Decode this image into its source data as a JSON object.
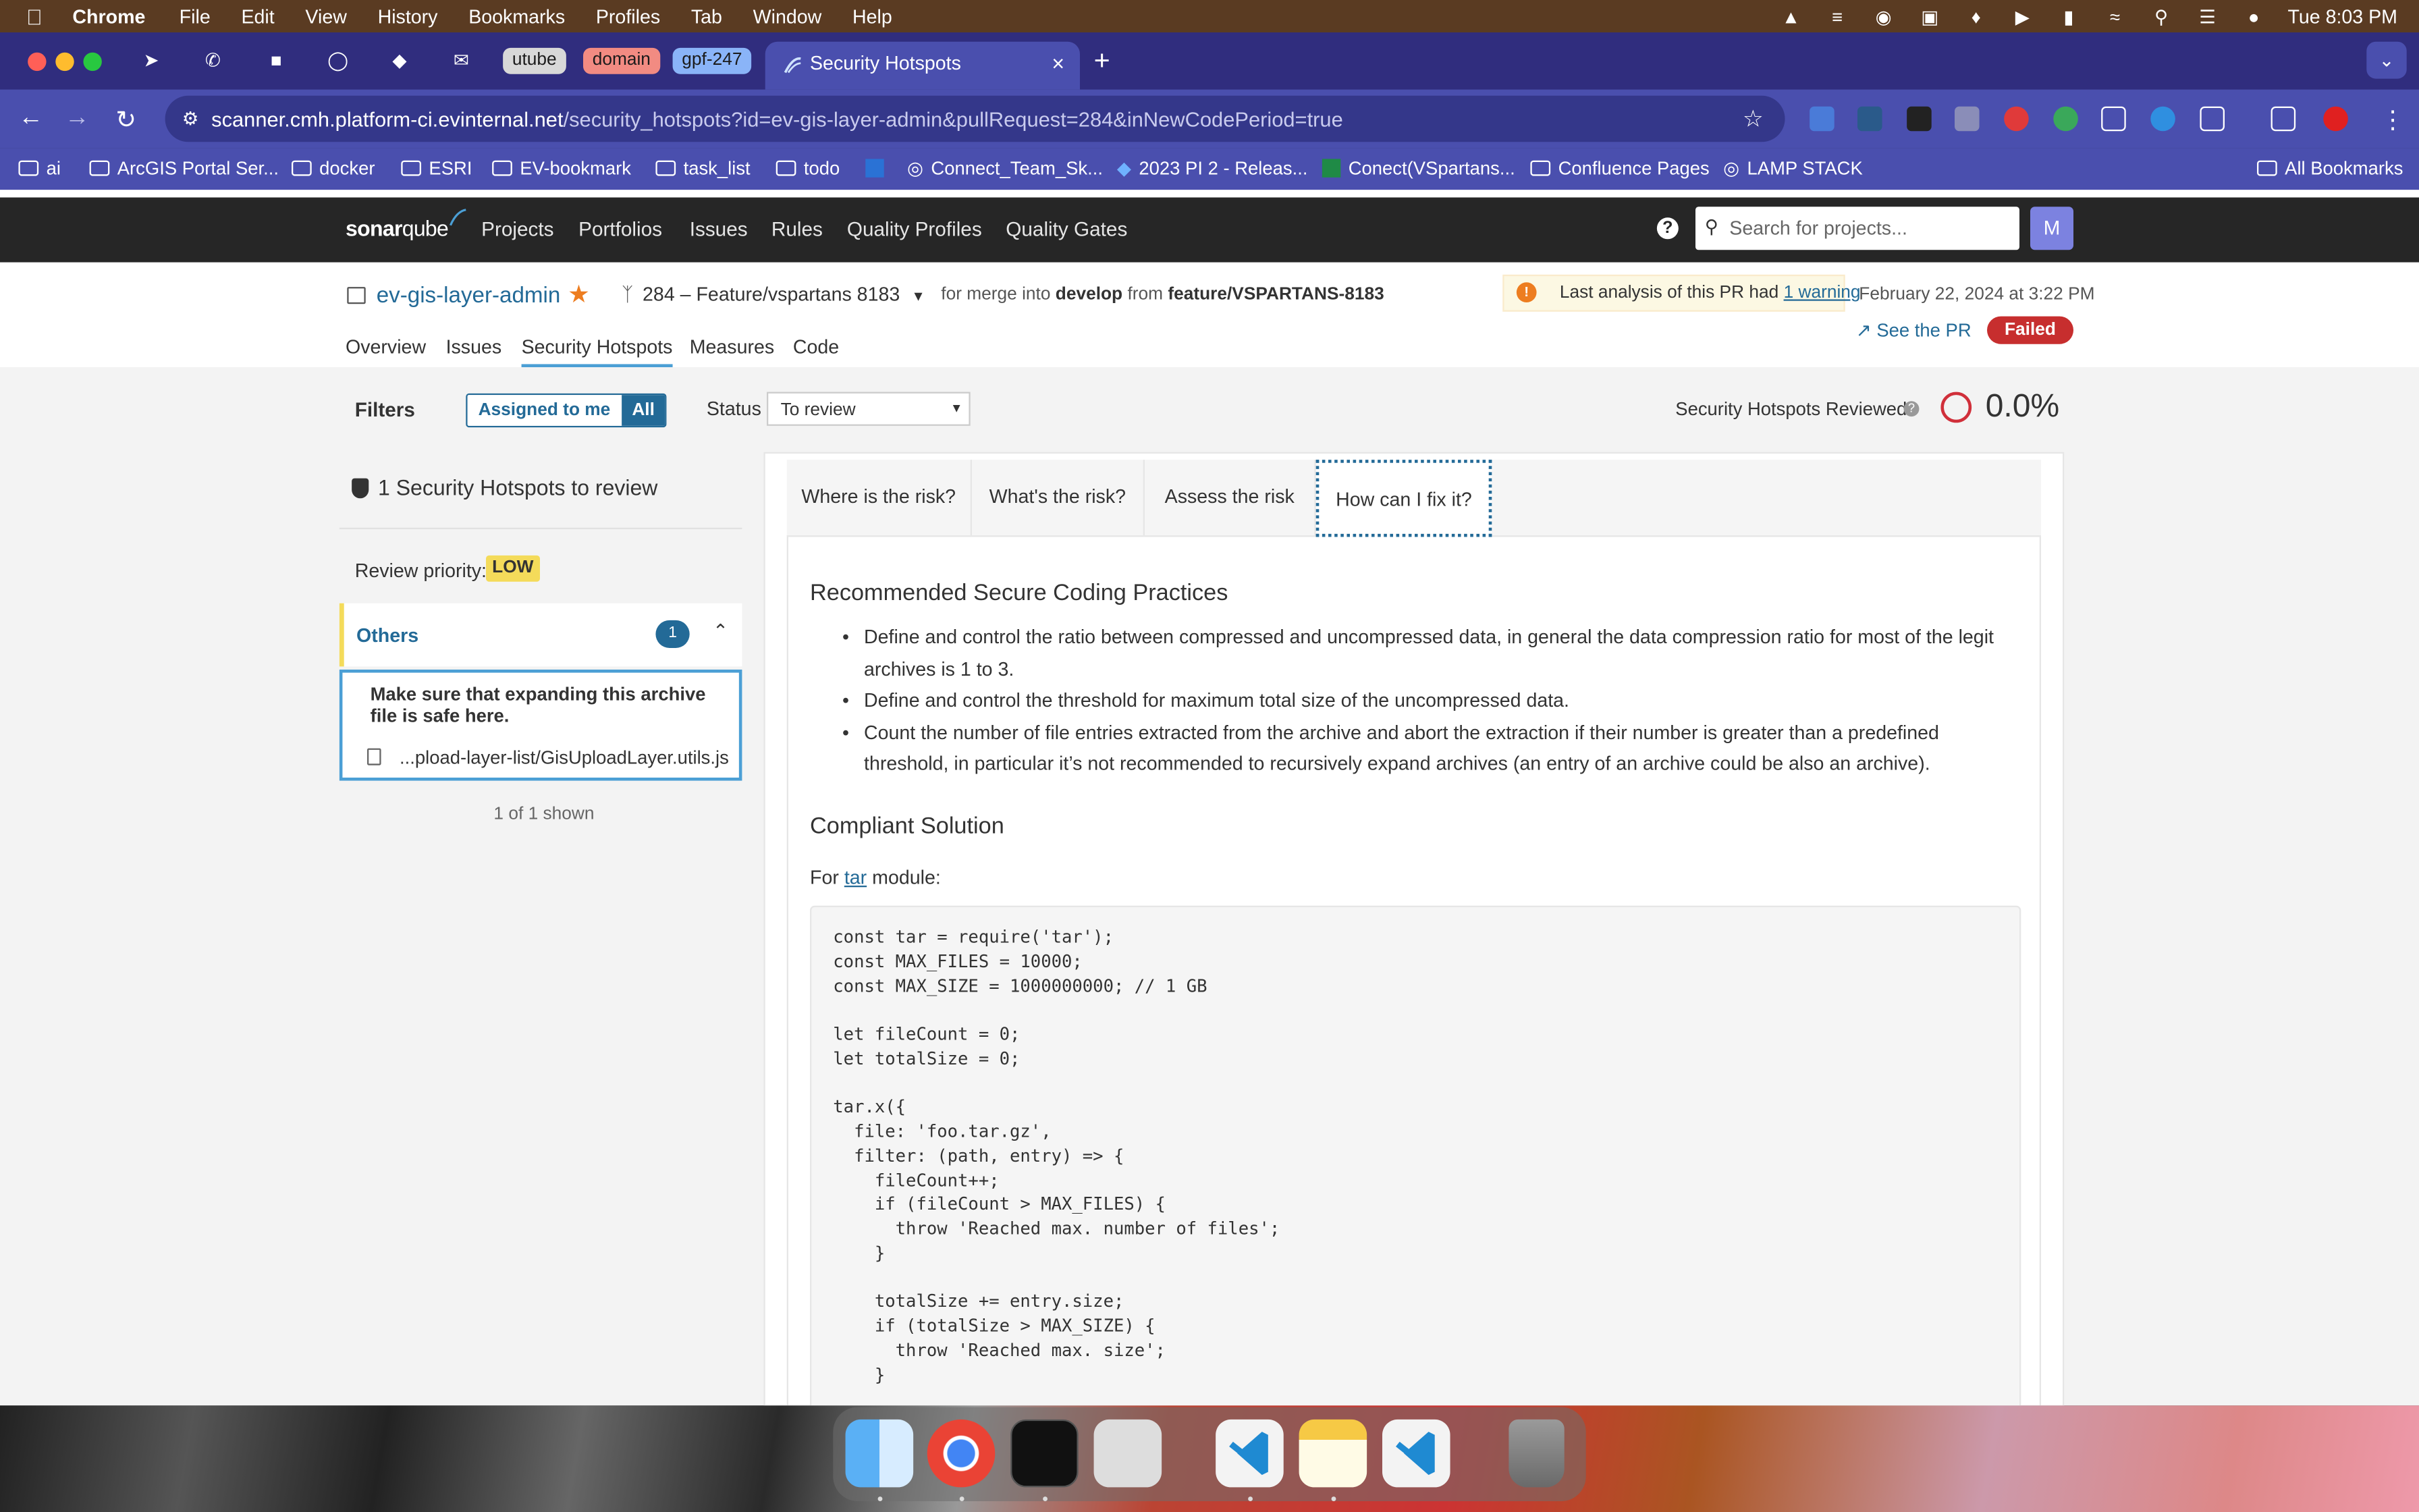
{
  "menubar": {
    "app": "Chrome",
    "items": [
      "File",
      "Edit",
      "View",
      "History",
      "Bookmarks",
      "Profiles",
      "Tab",
      "Window",
      "Help"
    ],
    "clock": "Tue 8:03 PM"
  },
  "tabs": {
    "groups": [
      "utube",
      "domain",
      "gpf-247"
    ],
    "group_colors": [
      "#d8d8d8",
      "#f28b82",
      "#8ab4f8"
    ],
    "active_title": "Security Hotspots"
  },
  "url": {
    "host": "scanner.cmh.platform-ci.evinternal.net",
    "path": "/security_hotspots?id=ev-gis-layer-admin&pullRequest=284&inNewCodePeriod=true"
  },
  "bookmarks": [
    "ai",
    "ArcGIS Portal Ser...",
    "docker",
    "ESRI",
    "EV-bookmark",
    "task_list",
    "todo",
    "Connect_Team_Sk...",
    "2023 PI 2 - Releas...",
    "Conect(VSpartans...",
    "Confluence Pages",
    "LAMP STACK",
    "All Bookmarks"
  ],
  "sonar": {
    "logo_bold": "sonar",
    "logo_rest": "qube",
    "nav": [
      "Projects",
      "Portfolios",
      "Issues",
      "Rules",
      "Quality Profiles",
      "Quality Gates"
    ],
    "search_placeholder": "Search for projects...",
    "avatar": "M"
  },
  "project": {
    "name": "ev-gis-layer-admin",
    "branch": "284 – Feature/vspartans 8183",
    "merge_prefix": "for merge into",
    "merge_target": "develop",
    "merge_from": "from",
    "merge_source": "feature/VSPARTANS-8183",
    "warning_text": "Last analysis of this PR had",
    "warning_link": "1 warning",
    "date": "February 22, 2024 at 3:22 PM",
    "see_pr": "See the PR",
    "gate": "Failed",
    "subnav": [
      "Overview",
      "Issues",
      "Security Hotspots",
      "Measures",
      "Code"
    ]
  },
  "filters": {
    "label": "Filters",
    "assigned": "Assigned to me",
    "all": "All",
    "status_label": "Status",
    "status_value": "To review",
    "reviewed_label": "Security Hotspots Reviewed",
    "reviewed_pct": "0.0%"
  },
  "sidebar": {
    "count_text": "1 Security Hotspots to review",
    "priority_label": "Review priority:",
    "priority": "LOW",
    "category": "Others",
    "category_count": "1",
    "hotspot_msg": "Make sure that expanding this archive file is safe here.",
    "file": "...pload-layer-list/GisUploadLayer.utils.js",
    "shown": "1 of 1 shown"
  },
  "detail": {
    "tabs": [
      "Where is the risk?",
      "What's the risk?",
      "Assess the risk",
      "How can I fix it?"
    ],
    "h_practices": "Recommended Secure Coding Practices",
    "practices": [
      "Define and control the ratio between compressed and uncompressed data, in general the data compression ratio for most of the legit archives is 1 to 3.",
      "Define and control the threshold for maximum total size of the uncompressed data.",
      "Count the number of file entries extracted from the archive and abort the extraction if their number is greater than a predefined threshold, in particular it’s not recommended to recursively expand archives (an entry of an archive could be also an archive)."
    ],
    "h_solution": "Compliant Solution",
    "for_prefix": "For",
    "for_link": "tar",
    "for_suffix": "module:",
    "code": "const tar = require('tar');\nconst MAX_FILES = 10000;\nconst MAX_SIZE = 1000000000; // 1 GB\n\nlet fileCount = 0;\nlet totalSize = 0;\n\ntar.x({\n  file: 'foo.tar.gz',\n  filter: (path, entry) => {\n    fileCount++;\n    if (fileCount > MAX_FILES) {\n      throw 'Reached max. number of files';\n    }\n\n    totalSize += entry.size;\n    if (totalSize > MAX_SIZE) {\n      throw 'Reached max. size';\n    }"
  }
}
